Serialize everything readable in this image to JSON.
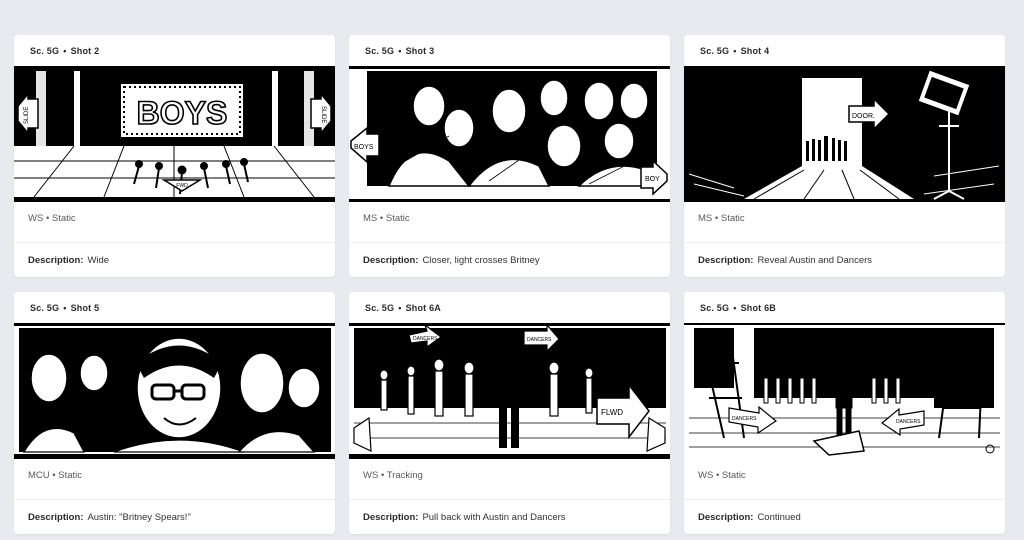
{
  "shots": [
    {
      "scene": "Sc. 5G",
      "shot": "Shot 2",
      "framing": "WS",
      "movement": "Static",
      "description_label": "Description:",
      "description": "Wide",
      "frame_text": "BOYS",
      "arrow_left": "SLIDE",
      "arrow_right": "SLIDE",
      "arrow_bottom": "FWD"
    },
    {
      "scene": "Sc. 5G",
      "shot": "Shot 3",
      "framing": "MS",
      "movement": "Static",
      "description_label": "Description:",
      "description": "Closer, light crosses Britney",
      "arrow_left": "BOYS",
      "arrow_right": "BOY"
    },
    {
      "scene": "Sc. 5G",
      "shot": "Shot 4",
      "framing": "MS",
      "movement": "Static",
      "description_label": "Description:",
      "description": "Reveal Austin and Dancers",
      "arrow_sign": "DOOR."
    },
    {
      "scene": "Sc. 5G",
      "shot": "Shot 5",
      "framing": "MCU",
      "movement": "Static",
      "description_label": "Description:",
      "description": "Austin: \"Britney Spears!\""
    },
    {
      "scene": "Sc. 5G",
      "shot": "Shot 6A",
      "framing": "WS",
      "movement": "Tracking",
      "description_label": "Description:",
      "description": "Pull back with Austin and Dancers",
      "arrow_left": "DANCERS",
      "arrow_right": "DANCERS",
      "arrow_fwd": "FLWD"
    },
    {
      "scene": "Sc. 5G",
      "shot": "Shot 6B",
      "framing": "WS",
      "movement": "Static",
      "description_label": "Description:",
      "description": "Continued",
      "arrow_left": "DANCERS",
      "arrow_right": "DANCERS"
    }
  ],
  "separator": "•"
}
